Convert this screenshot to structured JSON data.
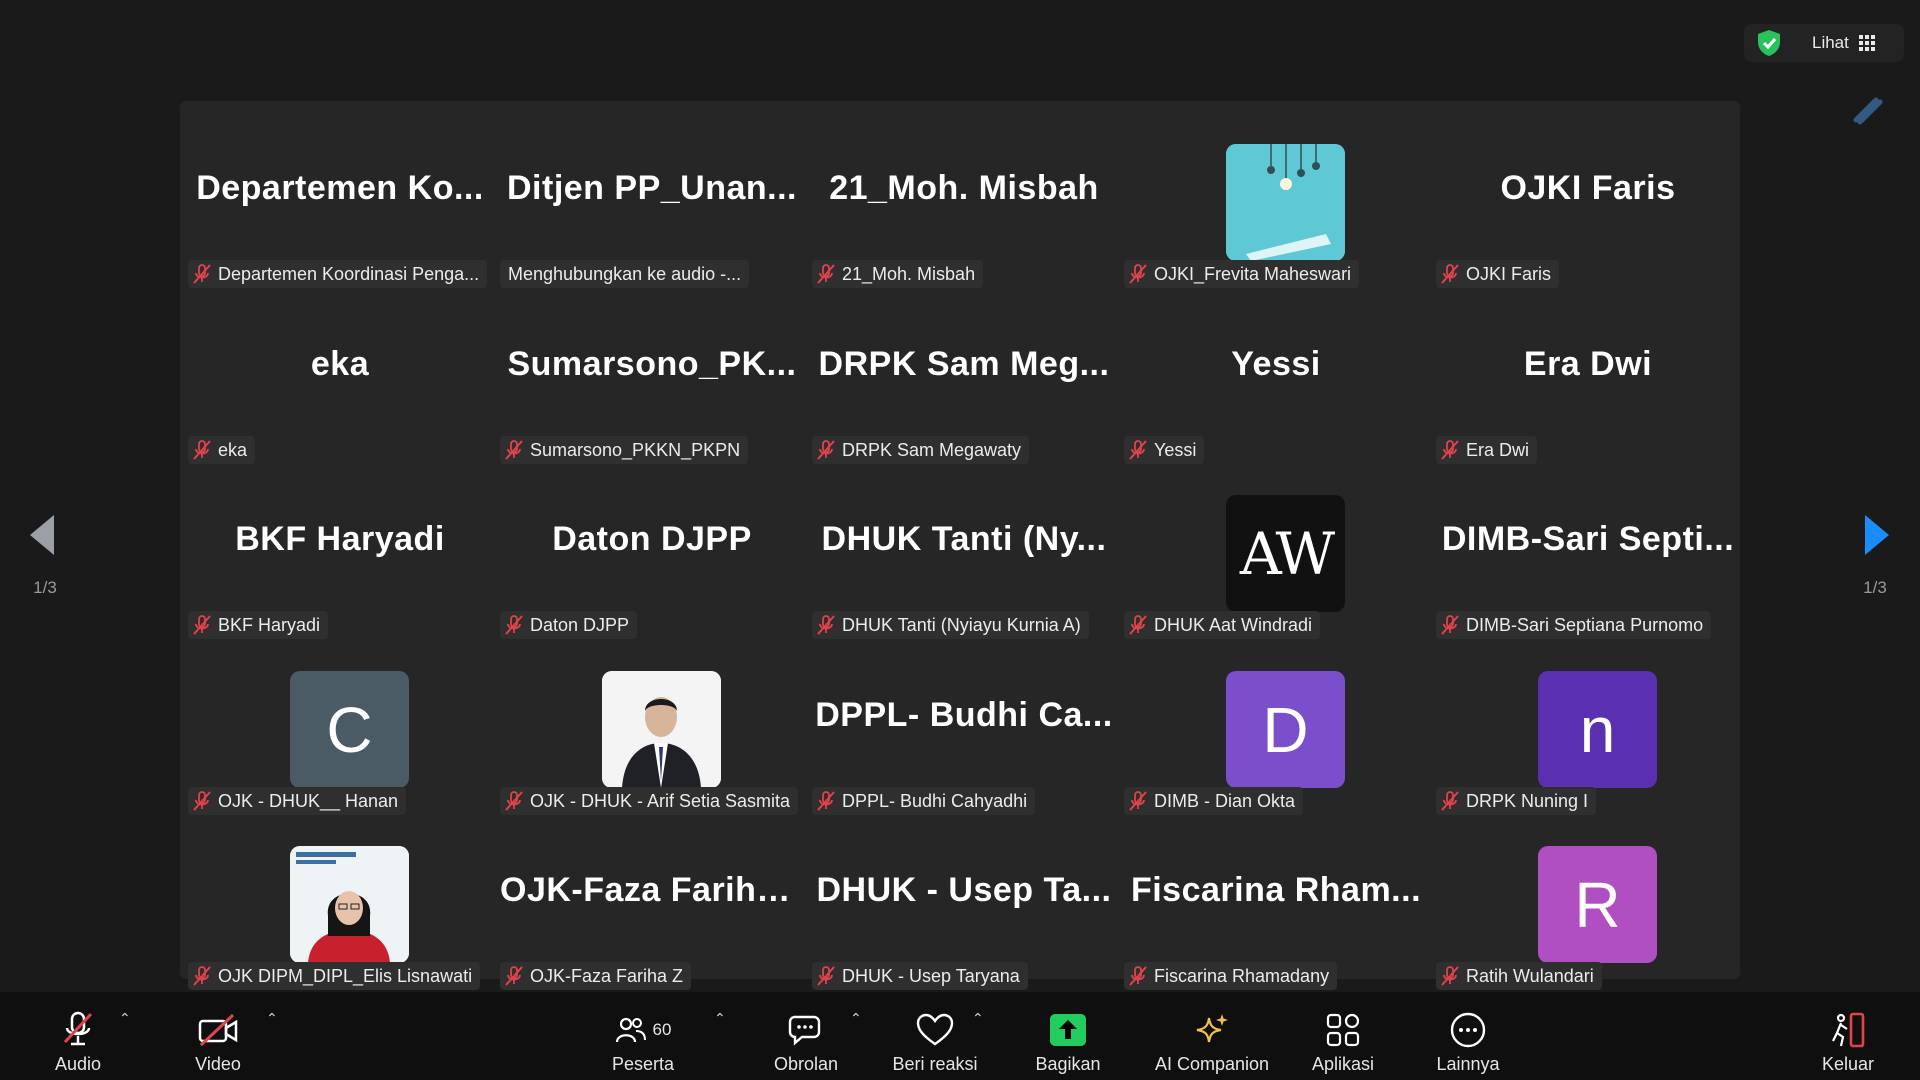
{
  "header": {
    "view_label": "Lihat"
  },
  "pagination": {
    "left": "1/3",
    "right": "1/3"
  },
  "tiles": [
    {
      "name": "Departemen  Ko...",
      "label": "Departemen Koordinasi Penga...",
      "muted": true,
      "avatar": null
    },
    {
      "name": "Ditjen  PP_Unan...",
      "label": "Menghubungkan ke audio -...",
      "muted": false,
      "avatar": null
    },
    {
      "name": "21_Moh. Misbah",
      "label": "21_Moh. Misbah",
      "muted": true,
      "avatar": null
    },
    {
      "name": "",
      "label": "OJKI_Frevita Maheswari",
      "muted": true,
      "avatar": {
        "type": "image",
        "kind": "lamps",
        "bg": "#5ec9d4"
      }
    },
    {
      "name": "OJKI Faris",
      "label": "OJKI Faris",
      "muted": true,
      "avatar": null
    },
    {
      "name": "eka",
      "label": "eka",
      "muted": true,
      "avatar": null
    },
    {
      "name": "Sumarsono_PK...",
      "label": "Sumarsono_PKKN_PKPN",
      "muted": true,
      "avatar": null
    },
    {
      "name": "DRPK  Sam  Meg...",
      "label": "DRPK Sam Megawaty",
      "muted": true,
      "avatar": null
    },
    {
      "name": "Yessi",
      "label": "Yessi",
      "muted": true,
      "avatar": null
    },
    {
      "name": "Era Dwi",
      "label": "Era Dwi",
      "muted": true,
      "avatar": null
    },
    {
      "name": "BKF Haryadi",
      "label": "BKF Haryadi",
      "muted": true,
      "avatar": null
    },
    {
      "name": "Daton DJPP",
      "label": "Daton DJPP",
      "muted": true,
      "avatar": null
    },
    {
      "name": "DHUK  Tanti  (Ny...",
      "label": "DHUK Tanti (Nyiayu Kurnia A)",
      "muted": true,
      "avatar": null
    },
    {
      "name": "",
      "label": "DHUK Aat Windradi",
      "muted": true,
      "avatar": {
        "type": "logo",
        "text": "AW",
        "bg": "#111111"
      }
    },
    {
      "name": "DIMB-Sari  Septi...",
      "label": "DIMB-Sari Septiana Purnomo",
      "muted": true,
      "avatar": null
    },
    {
      "name": "",
      "label": "OJK - DHUK__ Hanan",
      "muted": true,
      "avatar": {
        "type": "letter",
        "text": "C",
        "bg": "#4b5b66"
      }
    },
    {
      "name": "",
      "label": "OJK - DHUK - Arif Setia Sasmita",
      "muted": true,
      "avatar": {
        "type": "image",
        "kind": "man-suit",
        "bg": "#f4f4f4"
      }
    },
    {
      "name": "DPPL-  Budhi  Ca...",
      "label": "DPPL- Budhi Cahyadhi",
      "muted": true,
      "avatar": null
    },
    {
      "name": "",
      "label": "DIMB - Dian Okta",
      "muted": true,
      "avatar": {
        "type": "letter",
        "text": "D",
        "bg": "#7b4fcb"
      }
    },
    {
      "name": "",
      "label": "DRPK Nuning I",
      "muted": true,
      "avatar": {
        "type": "letter",
        "text": "n",
        "bg": "#5a2fb0"
      }
    },
    {
      "name": "",
      "label": "OJK DIPM_DIPL_Elis Lisnawati",
      "muted": true,
      "avatar": {
        "type": "image",
        "kind": "woman",
        "bg": "#eef3f6"
      }
    },
    {
      "name": "OJK-Faza Fariha Z",
      "label": "OJK-Faza Fariha Z",
      "muted": true,
      "avatar": null
    },
    {
      "name": "DHUK  -  Usep  Ta...",
      "label": "DHUK - Usep Taryana",
      "muted": true,
      "avatar": null
    },
    {
      "name": "Fiscarina  Rham...",
      "label": "Fiscarina Rhamadany",
      "muted": true,
      "avatar": null
    },
    {
      "name": "",
      "label": "Ratih Wulandari",
      "muted": true,
      "avatar": {
        "type": "letter",
        "text": "R",
        "bg": "#b04fc2"
      }
    }
  ],
  "toolbar": {
    "audio": "Audio",
    "video": "Video",
    "participants": "Peserta",
    "participants_count": "60",
    "chat": "Obrolan",
    "react": "Beri reaksi",
    "share": "Bagikan",
    "ai": "AI Companion",
    "apps": "Aplikasi",
    "more": "Lainnya",
    "leave": "Keluar"
  },
  "colors": {
    "accent_blue": "#1b8dfb",
    "mute_red": "#e0434c",
    "share_green": "#1fcc5d",
    "shield_green": "#27c25c",
    "ai_gold": "#f2c14b"
  }
}
